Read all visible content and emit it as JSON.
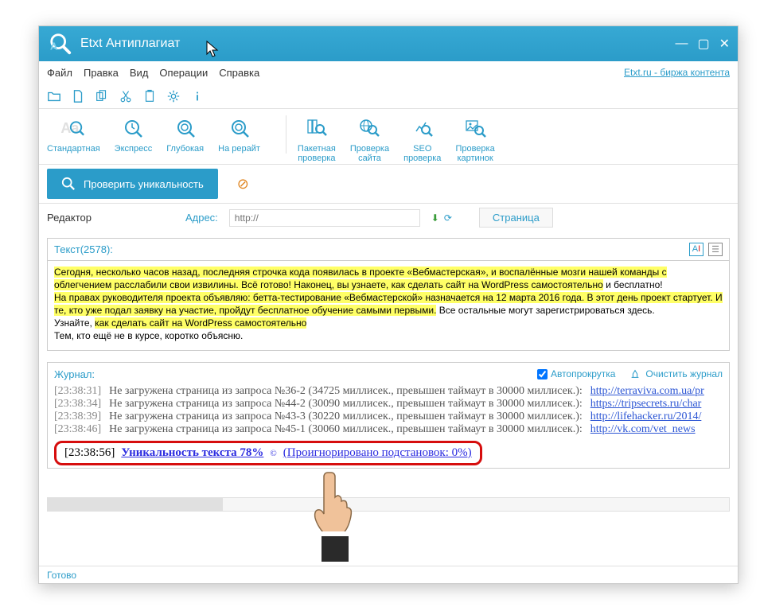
{
  "title": "Etxt Антиплагиат",
  "menubar": {
    "items": [
      "Файл",
      "Правка",
      "Вид",
      "Операции",
      "Справка"
    ],
    "link": "Etxt.ru - биржа контента"
  },
  "modes": {
    "standard": "Стандартная",
    "express": "Экспресс",
    "deep": "Глубокая",
    "rewrite": "На рерайт",
    "batch": "Пакетная\nпроверка",
    "site": "Проверка\nсайта",
    "seo": "SEO\nпроверка",
    "images": "Проверка\nкартинок"
  },
  "actions": {
    "check": "Проверить уникальность"
  },
  "address": {
    "editor_tab": "Редактор",
    "label": "Адрес:",
    "placeholder": "http://",
    "page_tab": "Страница"
  },
  "editor": {
    "head": "Текст(2578):",
    "body": {
      "seg1": "Сегодня, несколько часов назад, последняя строчка кода появилась в проекте «Вебмастерская», и воспалённые мозги нашей команды с облегчением расслабили свои извилины. Всё готово! Наконец, вы узнаете, ",
      "seg2": "как сделать сайт на WordPress самостоятельно",
      "seg3": " и бесплатно!",
      "seg4": "На правах руководителя проекта объявляю: бетта-тестирование «Вебмастерской» назначается на 12 марта 2016 года. В этот день проект стартует. И те, кто уже подал заявку на участие, пройдут бесплатное обучение самыми первыми.",
      "seg5": " Все остальные могут зарегистрироваться здесь.",
      "seg6": "Узнайте, ",
      "seg7": "как сделать сайт на WordPress самостоятельно",
      "seg8": "Тем, кто ещё не в курсе, коротко объясню."
    }
  },
  "log": {
    "head": "Журнал:",
    "autoscroll": "Автопрокрутка",
    "clear": "Очистить журнал",
    "rows": [
      {
        "time": "[23:38:31]",
        "text": "Не загружена страница из запроса №36-2 (34725 миллисек., превышен таймаут в 30000 миллисек.):",
        "link": "http://terraviva.com.ua/pr"
      },
      {
        "time": "[23:38:34]",
        "text": "Не загружена страница из запроса №44-2 (30090 миллисек., превышен таймаут в 30000 миллисек.):",
        "link": "https://tripsecrets.ru/char"
      },
      {
        "time": "[23:38:39]",
        "text": "Не загружена страница из запроса №43-3 (30220 миллисек., превышен таймаут в 30000 миллисек.):",
        "link": "http://lifehacker.ru/2014/"
      },
      {
        "time": "[23:38:46]",
        "text": "Не загружена страница из запроса №45-1 (30060 миллисек., превышен таймаут в 30000 миллисек.):",
        "link": "http://vk.com/vet_news"
      }
    ],
    "result": {
      "time": "[23:38:56]",
      "text": "Уникальность текста 78%",
      "copy": "©",
      "ignore": "(Проигнорировано подстановок: 0%)"
    }
  },
  "status": "Готово"
}
